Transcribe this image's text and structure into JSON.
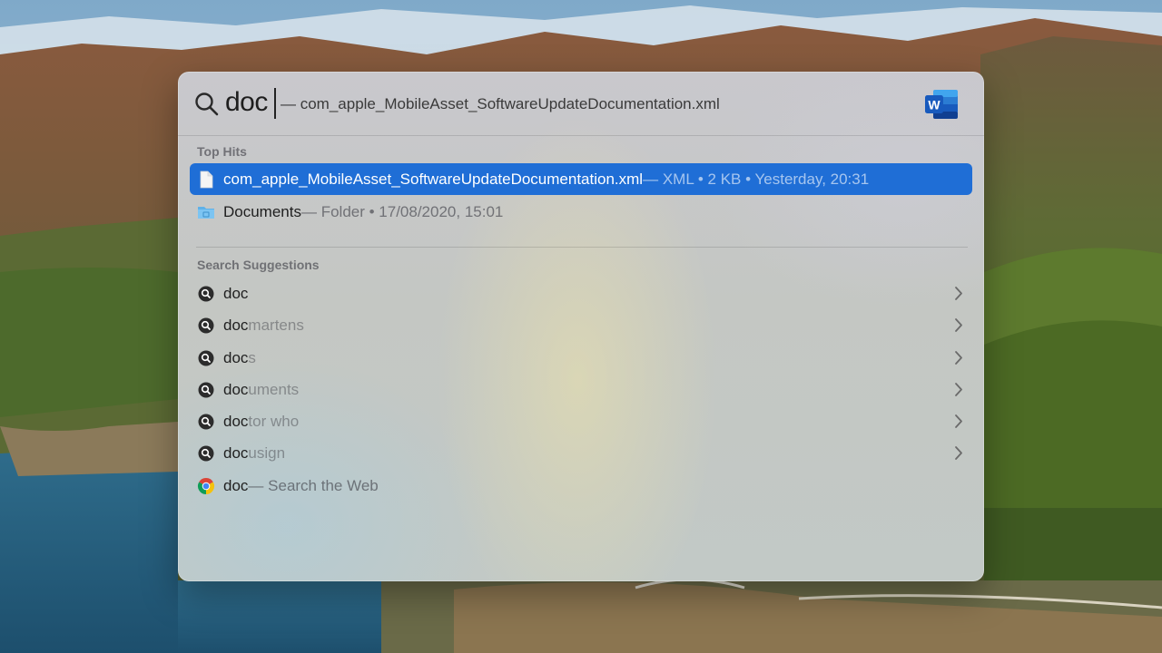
{
  "search": {
    "query": "doc",
    "completion": "— com_apple_MobileAsset_SoftwareUpdateDocumentation.xml",
    "preview_app_icon": "word-icon"
  },
  "top_hits": {
    "header": "Top Hits",
    "items": [
      {
        "title": "com_apple_MobileAsset_SoftwareUpdateDocumentation.xml",
        "meta": " — XML • 2 KB • Yesterday, 20:31",
        "icon": "document-icon",
        "selected": true
      },
      {
        "title": "Documents",
        "meta": " — Folder • 17/08/2020, 15:01",
        "icon": "folder-icon",
        "selected": false
      }
    ]
  },
  "suggestions": {
    "header": "Search Suggestions",
    "items": [
      {
        "typed": "doc",
        "rest": "",
        "icon": "search-suggestion-icon"
      },
      {
        "typed": "doc",
        "rest": " martens",
        "icon": "search-suggestion-icon"
      },
      {
        "typed": "doc",
        "rest": "s",
        "icon": "search-suggestion-icon"
      },
      {
        "typed": "doc",
        "rest": "uments",
        "icon": "search-suggestion-icon"
      },
      {
        "typed": "doc",
        "rest": "tor who",
        "icon": "search-suggestion-icon"
      },
      {
        "typed": "doc",
        "rest": "usign",
        "icon": "search-suggestion-icon"
      }
    ],
    "web": {
      "typed": "doc",
      "rest": " — Search the Web",
      "icon": "chrome-icon"
    }
  },
  "colors": {
    "selection": "#1f6ed6",
    "word_blue": "#185abd"
  }
}
